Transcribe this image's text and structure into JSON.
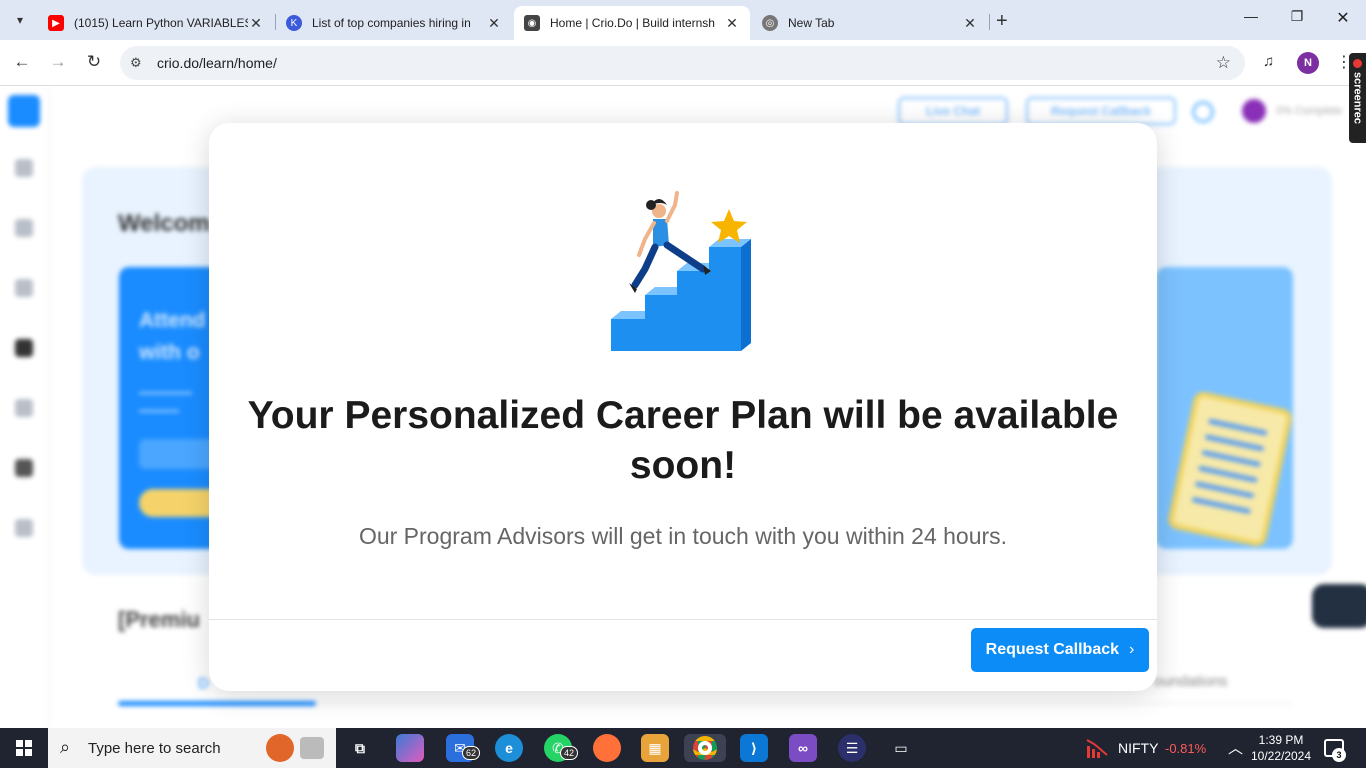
{
  "browser": {
    "tabs": [
      {
        "title": "(1015) Learn Python VARIABLES",
        "favicon": "youtube-icon",
        "active": false
      },
      {
        "title": "List of top companies hiring in",
        "favicon": "k-icon",
        "active": false
      },
      {
        "title": "Home | Crio.Do | Build internsh",
        "favicon": "crio-icon",
        "active": true
      },
      {
        "title": "New Tab",
        "favicon": "chrome-icon",
        "active": false
      }
    ],
    "url": "crio.do/learn/home/",
    "profile_initial": "N"
  },
  "page": {
    "top_buttons": {
      "live_chat": "Live Chat",
      "request_callback": "Request Callback"
    },
    "progress_label": "0% Complete",
    "welcome": "Welcom",
    "card_title_line1": "Attend",
    "card_title_line2": "with o",
    "premium_heading": "[Premiu",
    "tab_active_short": "D",
    "tab_right": "oundations",
    "screenrec_label": "screenrec"
  },
  "modal": {
    "title": "Your Personalized Career Plan will be available soon!",
    "subtitle": "Our Program Advisors will get in touch with you within 24 hours.",
    "cta_label": "Request Callback",
    "cta_chevron": "›",
    "illustration": "person-climbing-stairs-to-star"
  },
  "taskbar": {
    "search_placeholder": "Type here to search",
    "badges": {
      "mail": "62",
      "whatsapp": "42"
    },
    "nifty_label": "NIFTY",
    "nifty_change": "-0.81%",
    "time": "1:39 PM",
    "date": "10/22/2024",
    "notification_count": "3"
  },
  "colors": {
    "accent": "#0c8cf6",
    "tabbar": "#dfe7f5",
    "taskbar": "#1f2430",
    "nifty_negative": "#ff5a5a"
  }
}
